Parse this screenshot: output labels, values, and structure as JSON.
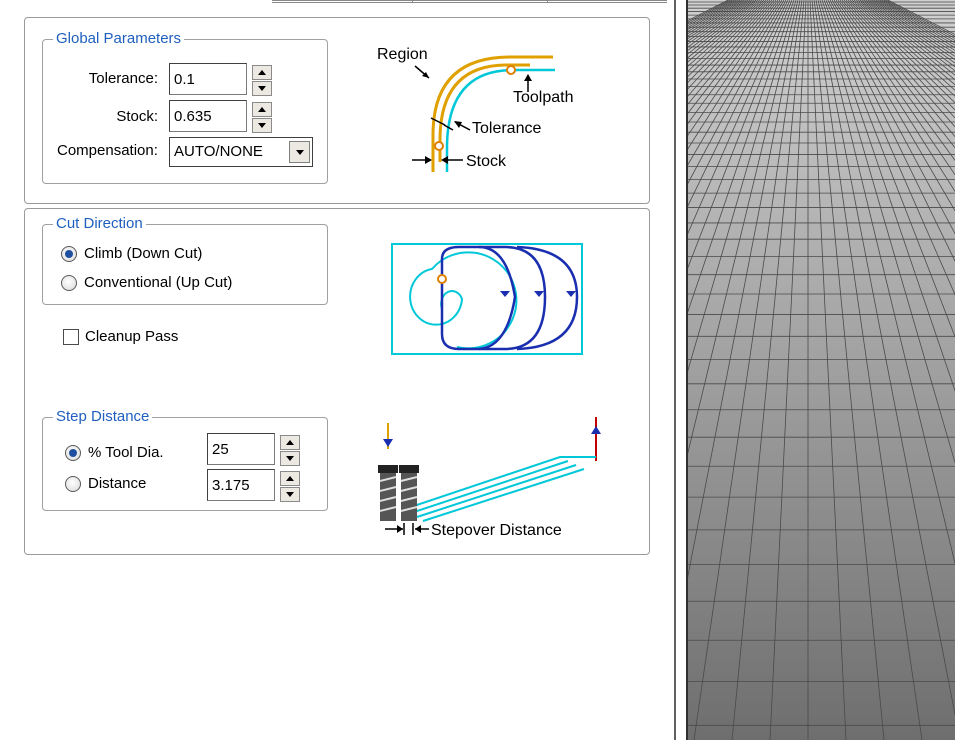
{
  "global_parameters": {
    "title": "Global Parameters",
    "tolerance_label": "Tolerance:",
    "tolerance_value": "0.1",
    "stock_label": "Stock:",
    "stock_value": "0.635",
    "compensation_label": "Compensation:",
    "compensation_value": "AUTO/NONE"
  },
  "tolerance_diagram": {
    "region_label": "Region",
    "toolpath_label": "Toolpath",
    "tolerance_label": "Tolerance",
    "stock_label": "Stock"
  },
  "cut_direction": {
    "title": "Cut Direction",
    "climb_label": "Climb (Down Cut)",
    "conventional_label": "Conventional (Up Cut)",
    "selected": "climb"
  },
  "cleanup_pass": {
    "label": "Cleanup Pass",
    "checked": false
  },
  "step_distance": {
    "title": "Step Distance",
    "percent_label": "% Tool Dia.",
    "percent_value": "25",
    "distance_label": "Distance",
    "distance_value": "3.175",
    "selected": "percent"
  },
  "stepover_diagram": {
    "label": "Stepover Distance"
  },
  "colors": {
    "legend_blue": "#1f5fbf",
    "region_orange": "#e0a000",
    "toolpath_cyan": "#00c8d8",
    "path_blue": "#1a2fb0"
  }
}
